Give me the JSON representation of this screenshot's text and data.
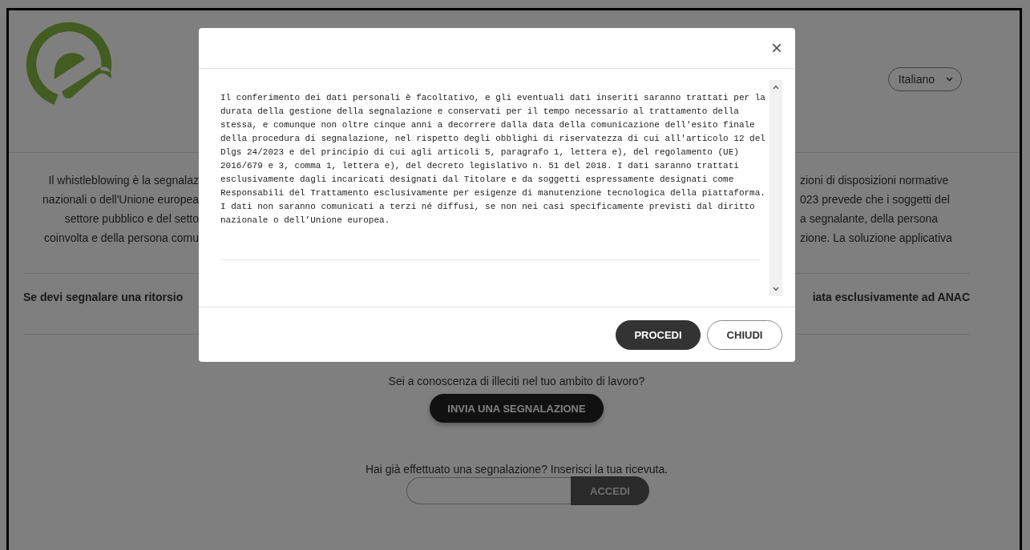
{
  "header": {
    "language": "Italiano"
  },
  "intro": {
    "lines": [
      {
        "left": "Il whistleblowing è la segnalaz",
        "right": "zioni di disposizioni normative"
      },
      {
        "left": "nazionali o dell'Unione europea",
        "right": "023 prevede che i soggetti del"
      },
      {
        "left": "settore pubblico e del setto",
        "right": "a segnalante, della persona"
      },
      {
        "left": "coinvolta e della persona comu",
        "right": "zione. La soluzione applicativa"
      }
    ]
  },
  "notice": {
    "left": "Se devi segnalare una ritorsio",
    "right": "iata esclusivamente ad ANAC"
  },
  "report": {
    "question": "Sei a conoscenza di illeciti nel tuo ambito di lavoro?",
    "button": "INVIA UNA SEGNALAZIONE"
  },
  "access": {
    "prompt": "Hai già effettuato una segnalazione? Inserisci la tua ricevuta.",
    "button": "ACCEDI"
  },
  "modal": {
    "close": "×",
    "text": "Il conferimento dei dati personali è facoltativo, e gli eventuali dati inseriti saranno trattati per la durata della gestione della segnalazione e conservati per il tempo necessario al trattamento della stessa, e comunque non oltre cinque anni a decorrere dalla data della comunicazione dell'esito finale della procedura di segnalazione, nel rispetto degli obblighi di riservatezza di cui all'articolo 12 del Dlgs 24/2023 e del principio di cui agli articoli 5, paragrafo 1, lettera e), del regolamento (UE) 2016/679 e 3, comma 1, lettera e), del decreto legislativo n. 51 del 2018. I dati saranno trattati esclusivamente dagli incaricati designati dal Titolare e da soggetti espressamente designati come Responsabili del Trattamento esclusivamente per esigenze di manutenzione tecnologica della piattaforma. I dati non saranno comunicati a terzi né diffusi, se non nei casi specificamente previsti dal diritto nazionale o dell’Unione europea.",
    "buttons": [
      {
        "label": "PROCEDI",
        "kind": "primary"
      },
      {
        "label": "CHIUDI",
        "kind": "secondary"
      }
    ]
  }
}
